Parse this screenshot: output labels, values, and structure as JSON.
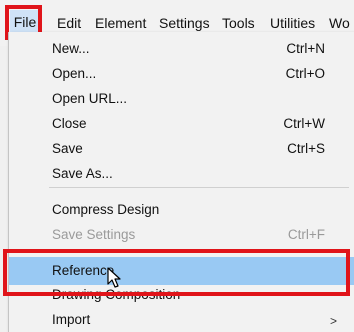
{
  "menubar": {
    "items": [
      {
        "label": "File"
      },
      {
        "label": "Edit"
      },
      {
        "label": "Element"
      },
      {
        "label": "Settings"
      },
      {
        "label": "Tools"
      },
      {
        "label": "Utilities"
      },
      {
        "label": "Wo"
      }
    ]
  },
  "file_menu": {
    "items": [
      {
        "label": "New...",
        "shortcut": "Ctrl+N"
      },
      {
        "label": "Open...",
        "shortcut": "Ctrl+O"
      },
      {
        "label": "Open URL...",
        "shortcut": ""
      },
      {
        "label": "Close",
        "shortcut": "Ctrl+W"
      },
      {
        "label": "Save",
        "shortcut": "Ctrl+S"
      },
      {
        "label": "Save As...",
        "shortcut": ""
      },
      {
        "label": "Compress Design",
        "shortcut": ""
      },
      {
        "label": "Save Settings",
        "shortcut": "Ctrl+F"
      },
      {
        "label": "Reference",
        "shortcut": ""
      },
      {
        "label": "Drawing Composition",
        "shortcut": ""
      },
      {
        "label": "Import",
        "shortcut": ""
      }
    ],
    "submenu_arrow": ">"
  },
  "colors": {
    "highlight_border": "#e0141a",
    "selected_background": "#99c9f3",
    "active_menubar_background": "#cfe2f7"
  }
}
